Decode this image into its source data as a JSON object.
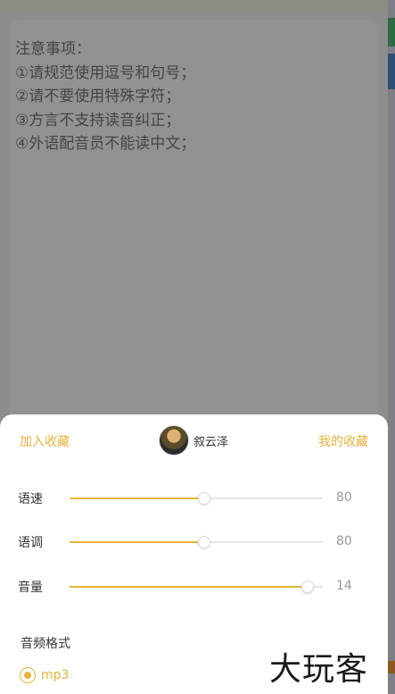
{
  "notice": {
    "lines": [
      "注意事项：",
      "①请规范使用逗号和句号；",
      "②请不要使用特殊字符；",
      "③方言不支持读音纠正；",
      "④外语配音员不能读中文；"
    ]
  },
  "sheet": {
    "add_favorite": "加入收藏",
    "my_favorites": "我的收藏",
    "voice_name": "叙云泽",
    "sliders": [
      {
        "label": "语速",
        "value": "80",
        "level": 0.53
      },
      {
        "label": "语调",
        "value": "80",
        "level": 0.53
      },
      {
        "label": "音量",
        "value": "14",
        "level": 0.94
      }
    ],
    "format_title": "音频格式",
    "format_selected": "mp3"
  },
  "watermark": "大玩客",
  "colors": {
    "accent": "#e8b23b",
    "overlay": "#8d8d8d"
  }
}
